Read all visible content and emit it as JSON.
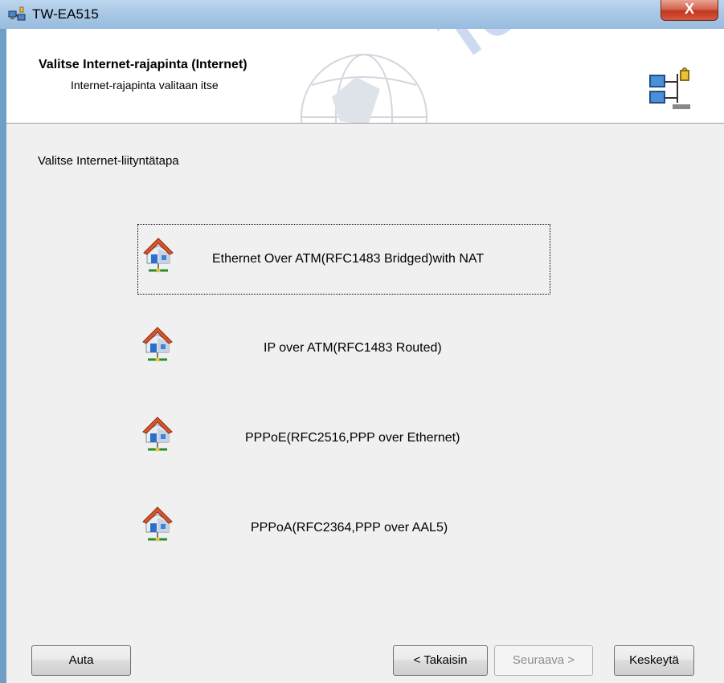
{
  "window": {
    "title": "TW-EA515",
    "close_glyph": "X"
  },
  "header": {
    "title": "Valitse Internet-rajapinta (Internet)",
    "subtitle": "Internet-rajapinta valitaan itse",
    "logo_icon": "network-setup-icon",
    "watermark_text": "Tele"
  },
  "section_label": "Valitse Internet-liityntätapa",
  "options": [
    {
      "label": "Ethernet Over ATM(RFC1483 Bridged)with NAT",
      "icon": "network-house-icon",
      "focused": true
    },
    {
      "label": "IP over ATM(RFC1483 Routed)",
      "icon": "network-house-icon",
      "focused": false
    },
    {
      "label": "PPPoE(RFC2516,PPP over Ethernet)",
      "icon": "network-house-icon",
      "focused": false
    },
    {
      "label": "PPPoA(RFC2364,PPP over AAL5)",
      "icon": "network-house-icon",
      "focused": false
    }
  ],
  "buttons": {
    "help": "Auta",
    "back": "< Takaisin",
    "next": "Seuraava >",
    "next_enabled": false,
    "cancel": "Keskeytä"
  },
  "colors": {
    "titlebar": "#a9c8e6",
    "close": "#c0381f",
    "client": "#f0f0f0"
  }
}
